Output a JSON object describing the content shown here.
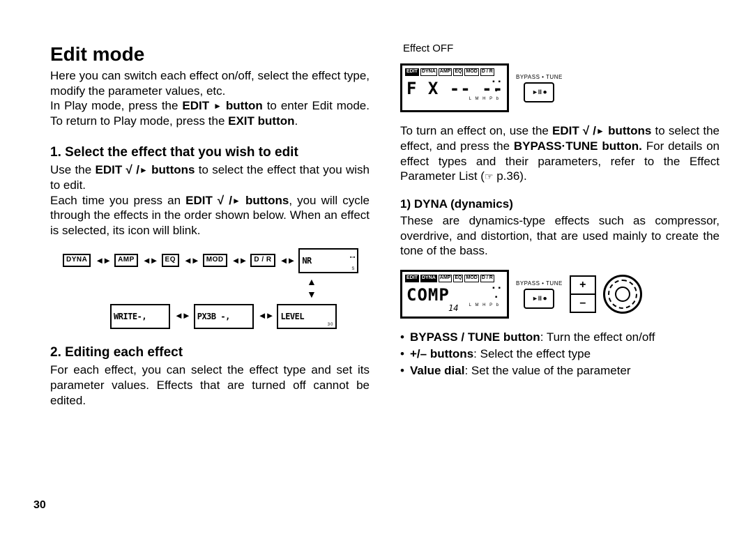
{
  "page_number": "30",
  "left": {
    "heading": "Edit mode",
    "intro1": "Here you can switch each effect on/off, select the effect type, modify the parameter values, etc.",
    "intro2a": "In Play mode, press the ",
    "intro2_bold1": "EDIT ",
    "intro2_tri": "►",
    "intro2_bold2": " button",
    "intro2b": " to enter Edit mode. To return to Play mode, press the ",
    "intro2_bold3": "EXIT button",
    "intro2c": ".",
    "sec1_heading": "1. Select the effect that you wish to edit",
    "sec1_p1a": "Use the ",
    "sec1_p1_bold": "EDIT √ /",
    "sec1_p1_tri": "►",
    "sec1_p1_bold2": " buttons",
    "sec1_p1b": " to select the effect that you wish to edit.",
    "sec1_p2a": "Each time you press an ",
    "sec1_p2_bold": "EDIT √ /",
    "sec1_p2_tri": "►",
    "sec1_p2_bold2": " buttons",
    "sec1_p2b": ", you will cycle through the effects in the order shown below. When an effect is selected, its icon will blink.",
    "flow_top": [
      "DYNA",
      "AMP",
      "EQ",
      "MOD",
      "D / R"
    ],
    "flow_lcd_nr": "NR",
    "flow_lcd_write": "WRITE-,",
    "flow_lcd_px": "PX3B -,",
    "flow_lcd_level": "LEVEL",
    "sec2_heading": "2. Editing each effect",
    "sec2_p": "For each effect, you can select the effect type and set its parameter values. Effects that are turned off cannot be edited."
  },
  "right": {
    "caption_effect_off": "Effect OFF",
    "lcd1_hdr": [
      "EDIT",
      "DYNA",
      "AMP",
      "EQ",
      "MOD",
      "D / R"
    ],
    "lcd1_main": "F X  -- --",
    "lcd1_lmhp": "L M H P b",
    "btn1_cap": "BYPASS • TUNE",
    "btn1_sym": "►II  ⏺",
    "p1a": "To turn an effect on, use the ",
    "p1_bold1": "EDIT √ /",
    "p1_tri": "►",
    "p1_bold2": " buttons",
    "p1b": " to select the effect, and press the ",
    "p1_bold3": "BYPASS·TUNE button.",
    "p1c": " For details on effect types and their parameters, refer to the Effect Parameter List (",
    "p1_hand": "☞",
    "p1_ref": " p.36).",
    "sec3_heading": "1) DYNA (dynamics)",
    "sec3_p": "These are dynamics-type effects such as compressor, overdrive, and distortion, that are used mainly to create the tone of the bass.",
    "lcd2_main": "COMP",
    "lcd2_num": "14",
    "btn2_cap": "BYPASS • TUNE",
    "btn2_sym": "►II  ⏺",
    "pm_plus": "+",
    "pm_minus": "–",
    "bullets": [
      {
        "b": "BYPASS / TUNE button",
        "t": ": Turn the effect on/off"
      },
      {
        "b": "+/– buttons",
        "t": ": Select the effect type"
      },
      {
        "b": "Value dial",
        "t": ": Set the value of the parameter"
      }
    ]
  }
}
